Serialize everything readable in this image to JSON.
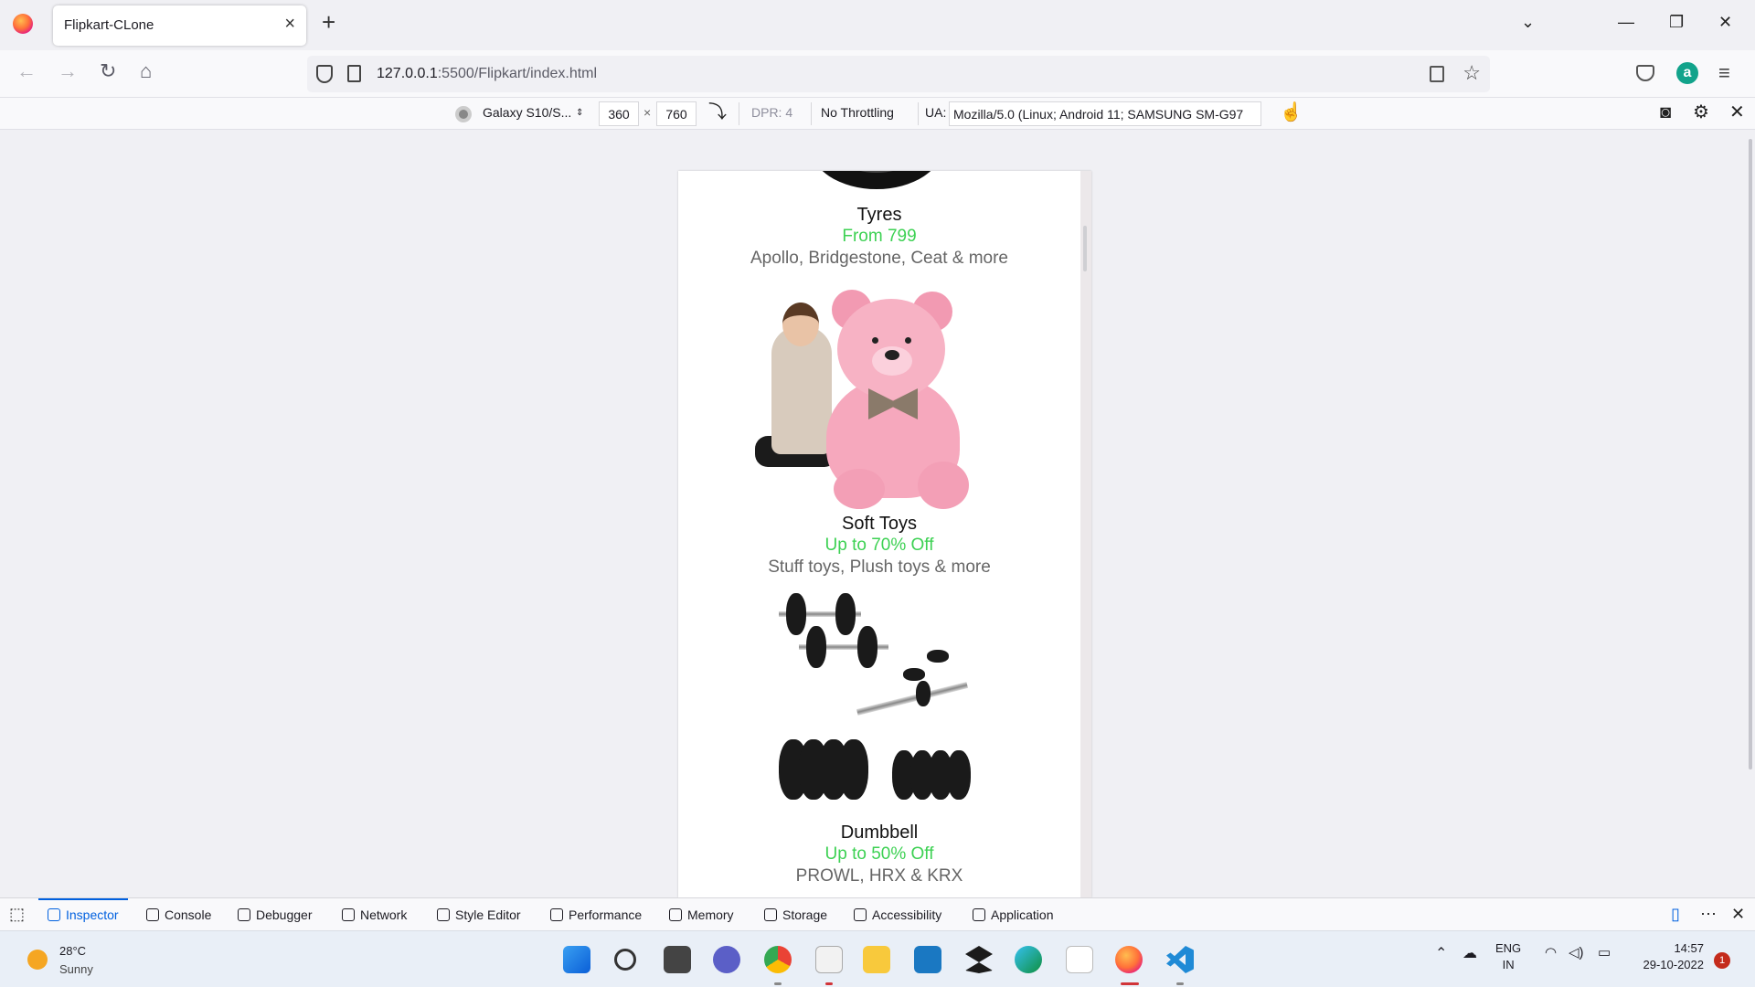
{
  "browser": {
    "tab_title": "Flipkart-CLone",
    "url_host": "127.0.0.1",
    "url_path": ":5500/Flipkart/index.html"
  },
  "rdm": {
    "device": "Galaxy S10/S...",
    "width": "360",
    "times": "×",
    "height": "760",
    "dpr": "DPR: 4",
    "throttling": "No Throttling",
    "ua_label": "UA:",
    "ua_value": "Mozilla/5.0 (Linux; Android 11; SAMSUNG SM-G97"
  },
  "products": [
    {
      "name": "Tyres",
      "offer": "From 799",
      "brands": "Apollo, Bridgestone, Ceat & more"
    },
    {
      "name": "Soft Toys",
      "offer": "Up to 70% Off",
      "brands": "Stuff toys, Plush toys & more"
    },
    {
      "name": "Dumbbell",
      "offer": "Up to 50% Off",
      "brands": "PROWL, HRX & KRX"
    }
  ],
  "devtools": {
    "tabs": [
      "Inspector",
      "Console",
      "Debugger",
      "Network",
      "Style Editor",
      "Performance",
      "Memory",
      "Storage",
      "Accessibility",
      "Application"
    ],
    "active_tab": "Inspector"
  },
  "taskbar": {
    "weather_temp": "28°C",
    "weather_desc": "Sunny",
    "lang_line1": "ENG",
    "lang_line2": "IN",
    "time": "14:57",
    "date": "29-10-2022",
    "notifications": "1"
  },
  "colors": {
    "offer_green": "#3dd153",
    "devtools_active": "#0060df",
    "teddy_pink": "#f6a8bd"
  }
}
